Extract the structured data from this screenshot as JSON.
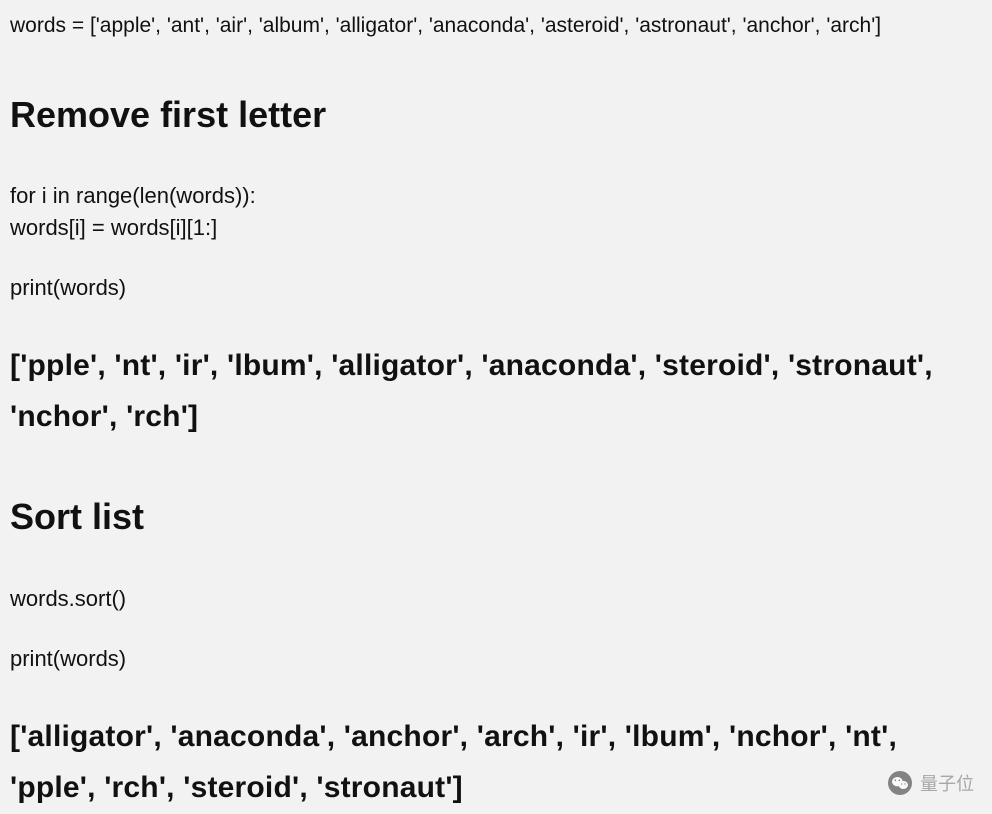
{
  "top_line": "words = ['apple', 'ant', 'air', 'album', 'alligator', 'anaconda', 'asteroid', 'astronaut', 'anchor', 'arch']",
  "section1": {
    "heading": "Remove first letter",
    "code_line1": "for i in range(len(words)):",
    "code_line2": "words[i] = words[i][1:]",
    "code_line3": "print(words)",
    "output": "['pple', 'nt', 'ir', 'lbum', 'alligator', 'anaconda', 'steroid', 'stronaut', 'nchor', 'rch']"
  },
  "section2": {
    "heading": "Sort list",
    "code_line1": "words.sort()",
    "code_line2": "print(words)",
    "output": "['alligator', 'anaconda', 'anchor',  'arch', 'ir',  'lbum', 'nchor', 'nt', 'pple', 'rch', 'steroid', 'stronaut']"
  },
  "watermark": {
    "text": "量子位"
  }
}
